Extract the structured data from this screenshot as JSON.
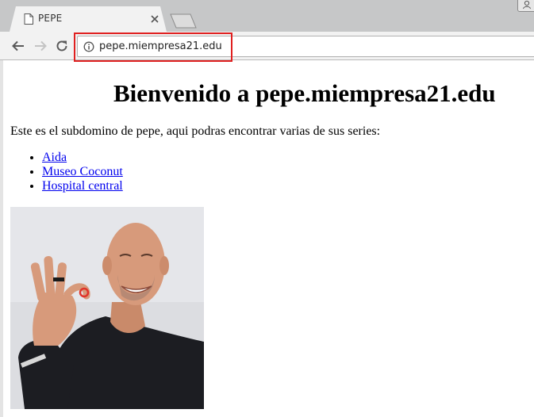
{
  "browser": {
    "tab_title": "PEPE",
    "url": "pepe.miempresa21.edu"
  },
  "page": {
    "heading": "Bienvenido a pepe.miempresa21.edu",
    "intro": "Este es el subdomino de pepe, aqui podras encontrar varias de sus series:",
    "series": [
      {
        "label": "Aida"
      },
      {
        "label": "Museo Coconut"
      },
      {
        "label": "Hospital central"
      }
    ]
  },
  "colors": {
    "link": "#0000ee",
    "highlight": "#e02020",
    "chrome": "#f2f2f2"
  }
}
